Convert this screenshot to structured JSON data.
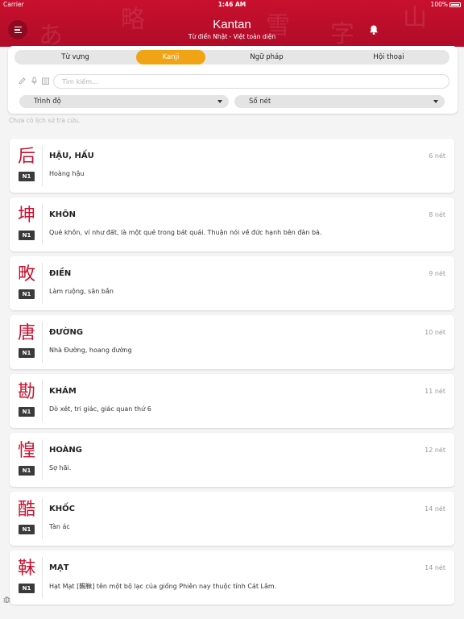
{
  "status_bar": {
    "carrier": "Carrier",
    "time": "1:46 AM",
    "battery": "100%"
  },
  "header": {
    "title": "Kantan",
    "subtitle": "Từ điển Nhật - Việt toàn diện",
    "background_glyphs": [
      "あ",
      "略",
      "雪",
      "字",
      "山"
    ]
  },
  "colors": {
    "brand_red": "#c8102e",
    "active_tab": "#f1a316",
    "badge": "#3a3a3a"
  },
  "tabs": [
    {
      "label": "Từ vựng",
      "active": false
    },
    {
      "label": "Kanji",
      "active": true
    },
    {
      "label": "Ngữ pháp",
      "active": false
    },
    {
      "label": "Hội thoại",
      "active": false
    }
  ],
  "search": {
    "placeholder": "Tìm kiếm...",
    "value": "",
    "tool_icons": [
      "pencil-icon",
      "microphone-icon",
      "camera-icon"
    ]
  },
  "filters": {
    "level_label": "Trình độ",
    "strokes_label": "Số nét"
  },
  "history_note": "Chưa có lịch sử tra cứu.",
  "kanji_list": [
    {
      "kanji": "后",
      "level": "N1",
      "reading": "HẬU, HẤU",
      "strokes": "6 nét",
      "meaning": "Hoàng hậu"
    },
    {
      "kanji": "坤",
      "level": "N1",
      "reading": "KHÔN",
      "strokes": "8 nét",
      "meaning": "Quẻ khôn, ví như đất, là một quẻ trong bát quái. Thuận nói về đức hạnh bên đàn bà."
    },
    {
      "kanji": "畋",
      "level": "N1",
      "reading": "ĐIỀN",
      "strokes": "9 nét",
      "meaning": "Làm ruộng, săn bắn"
    },
    {
      "kanji": "唐",
      "level": "N1",
      "reading": "ĐƯỜNG",
      "strokes": "10 nét",
      "meaning": "Nhà Đường, hoang đường"
    },
    {
      "kanji": "勘",
      "level": "N1",
      "reading": "KHÁM",
      "strokes": "11 nét",
      "meaning": "Dò xét, tri giác, giác quan thứ 6"
    },
    {
      "kanji": "惶",
      "level": "N1",
      "reading": "HOÀNG",
      "strokes": "12 nét",
      "meaning": "Sợ hãi."
    },
    {
      "kanji": "酷",
      "level": "N1",
      "reading": "KHỐC",
      "strokes": "14 nét",
      "meaning": "Tàn ác"
    },
    {
      "kanji": "靺",
      "level": "N1",
      "reading": "MẠT",
      "strokes": "14 nét",
      "meaning": "Hạt Mạt [鞨靺] tên một bộ lạc của giống Phiên nay thuộc tỉnh Cát Lâm."
    }
  ]
}
